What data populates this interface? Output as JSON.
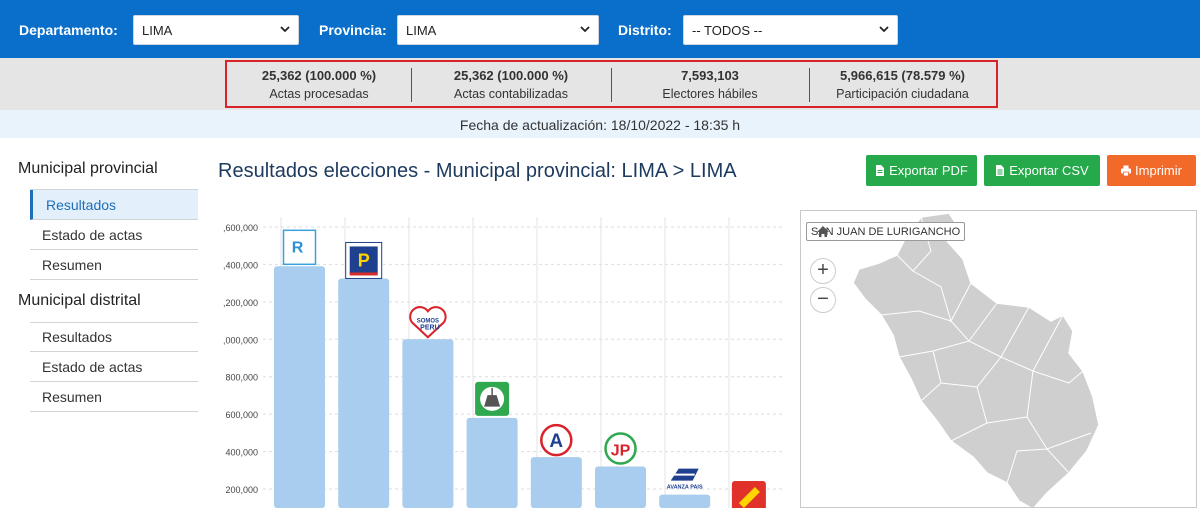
{
  "filters": {
    "departamento_label": "Departamento:",
    "departamento_value": "LIMA",
    "provincia_label": "Provincia:",
    "provincia_value": "LIMA",
    "distrito_label": "Distrito:",
    "distrito_value": "-- TODOS --"
  },
  "stats": [
    {
      "value": "25,362 (100.000 %)",
      "label": "Actas procesadas"
    },
    {
      "value": "25,362 (100.000 %)",
      "label": "Actas contabilizadas"
    },
    {
      "value": "7,593,103",
      "label": "Electores hábiles"
    },
    {
      "value": "5,966,615 (78.579 %)",
      "label": "Participación ciudadana"
    }
  ],
  "update_text": "Fecha de actualización: 18/10/2022 - 18:35 h",
  "sidebar": {
    "provincial_heading": "Municipal provincial",
    "provincial_items": [
      "Resultados",
      "Estado de actas",
      "Resumen"
    ],
    "distrital_heading": "Municipal distrital",
    "distrital_items": [
      "Resultados",
      "Estado de actas",
      "Resumen"
    ]
  },
  "title": "Resultados elecciones - Municipal provincial: LIMA > LIMA",
  "buttons": {
    "pdf": "Exportar PDF",
    "csv": "Exportar CSV",
    "print": "Imprimir"
  },
  "map": {
    "tooltip": "SAN JUAN DE LURIGANCHO",
    "zoom_in": "+",
    "zoom_out": "−"
  },
  "colors": {
    "header_blue": "#0a6fcb",
    "bar_blue": "#a8cdee",
    "button_green": "#26a94b",
    "button_orange": "#f26a2a",
    "highlight_red": "#d9222a"
  },
  "chart_data": {
    "type": "bar",
    "ytick_labels": [
      ",600,000",
      ",400,000",
      ",200,000",
      ",000,000",
      "800,000",
      "600,000",
      "400,000",
      "200,000"
    ],
    "yticks": [
      1600000,
      1400000,
      1200000,
      1000000,
      800000,
      600000,
      400000,
      200000
    ],
    "values": [
      1390000,
      1325000,
      1000000,
      580000,
      370000,
      320000,
      170000,
      0
    ],
    "bar_icons": [
      "renovacion-popular-logo",
      "podemos-logo",
      "somos-peru-logo",
      "partido-verde-logo",
      "accion-popular-logo",
      "juntos-peru-logo",
      "avanza-pais-logo",
      "pencil-party-logo"
    ],
    "icon_texts": [
      "R",
      "P",
      "SOMOS",
      "PERU",
      "A",
      "JP",
      "AVANZA PAIS"
    ]
  }
}
